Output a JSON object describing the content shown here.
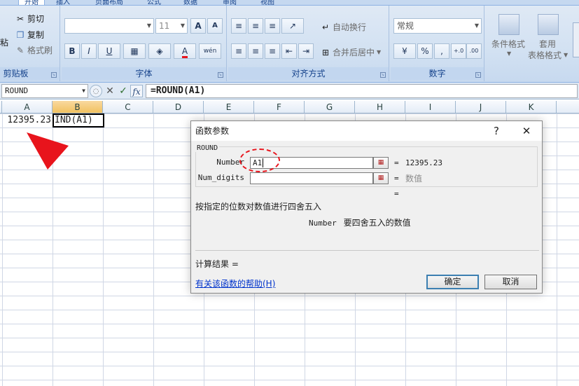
{
  "ribbon": {
    "tabs": [
      "开始",
      "插入",
      "页面布局",
      "公式",
      "数据",
      "审阅",
      "视图"
    ],
    "clipboard": {
      "paste_label": "粘",
      "cut_label": "剪切",
      "copy_label": "复制",
      "format_painter_label": "格式刷",
      "group_label": "剪贴板"
    },
    "font": {
      "font_name": "",
      "font_size": "11",
      "grow_icon_label": "A",
      "shrink_icon_label": "A",
      "bold": "B",
      "italic": "I",
      "underline": "U",
      "font_color_label": "A",
      "phonetic_label": "wén",
      "group_label": "字体"
    },
    "alignment": {
      "wrap_text_label": "自动换行",
      "merge_center_label": "合并后居中",
      "group_label": "对齐方式"
    },
    "number": {
      "format": "常规",
      "percent": "%",
      "comma": ",",
      "group_label": "数字"
    },
    "styles": {
      "conditional_label": "条件格式",
      "table_label_1": "套用",
      "table_label_2": "表格格式"
    }
  },
  "formula_bar": {
    "name_box": "ROUND",
    "cancel": "✕",
    "enter": "✓",
    "fx": "fx",
    "formula": "=ROUND(A1)"
  },
  "sheet": {
    "columns": [
      "A",
      "B",
      "C",
      "D",
      "E",
      "F",
      "G",
      "H",
      "I",
      "J",
      "K"
    ],
    "selected_column": "B",
    "a1_value": "12395.23",
    "b1_value": "IND(A1)"
  },
  "dialog": {
    "title": "函数参数",
    "help_ctrl": "?",
    "close_ctrl": "✕",
    "function_name": "ROUND",
    "args": [
      {
        "label": "Number",
        "value": "A1",
        "result": "12395.23"
      },
      {
        "label": "Num_digits",
        "value": "",
        "result": "数值"
      }
    ],
    "equals": "=",
    "function_result_eq": "=",
    "description": "按指定的位数对数值进行四舍五入",
    "arg_help_name": "Number",
    "arg_help_text": "要四舍五入的数值",
    "calc_result_label": "计算结果 =",
    "help_link": "有关该函数的帮助(H)",
    "ok_label": "确定",
    "cancel_label": "取消"
  },
  "colors": {
    "annotation_red": "#e8141c",
    "selected_column_header": "#f1c15f",
    "ribbon_label": "#15428b"
  }
}
